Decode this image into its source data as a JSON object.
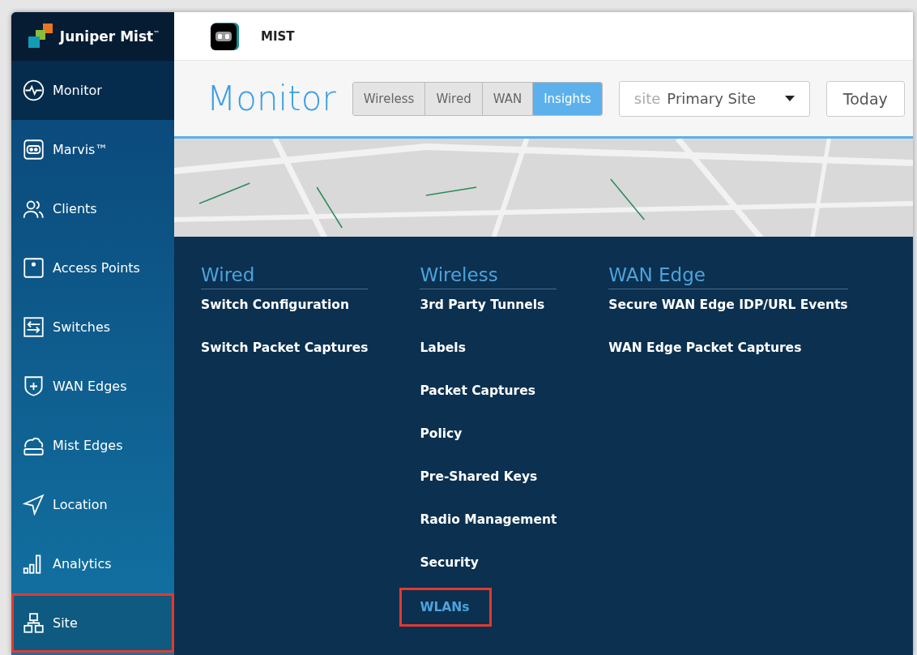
{
  "brand": {
    "name": "Juniper Mist",
    "trademark": "™"
  },
  "header": {
    "org": "MIST"
  },
  "sidebar": {
    "items": [
      {
        "label": "Monitor",
        "kind": "monitor",
        "active": true,
        "highlighted": false
      },
      {
        "label": "Marvis™",
        "kind": "marvis",
        "active": false,
        "highlighted": false
      },
      {
        "label": "Clients",
        "kind": "clients",
        "active": false,
        "highlighted": false
      },
      {
        "label": "Access Points",
        "kind": "ap",
        "active": false,
        "highlighted": false
      },
      {
        "label": "Switches",
        "kind": "switch",
        "active": false,
        "highlighted": false
      },
      {
        "label": "WAN Edges",
        "kind": "wan",
        "active": false,
        "highlighted": false
      },
      {
        "label": "Mist Edges",
        "kind": "mistedge",
        "active": false,
        "highlighted": false
      },
      {
        "label": "Location",
        "kind": "location",
        "active": false,
        "highlighted": false
      },
      {
        "label": "Analytics",
        "kind": "analytics",
        "active": false,
        "highlighted": false
      },
      {
        "label": "Site",
        "kind": "site",
        "active": false,
        "highlighted": true
      }
    ]
  },
  "page": {
    "title": "Monitor",
    "tabs": [
      {
        "label": "Wireless",
        "selected": false
      },
      {
        "label": "Wired",
        "selected": false
      },
      {
        "label": "WAN",
        "selected": false
      },
      {
        "label": "Insights",
        "selected": true
      }
    ],
    "site_select": {
      "label": "site",
      "value": "Primary Site"
    },
    "date_button": "Today"
  },
  "menu": {
    "columns": [
      {
        "title": "Wired",
        "items": [
          {
            "label": "Switch Configuration",
            "highlighted": false
          },
          {
            "label": "Switch Packet Captures",
            "highlighted": false
          }
        ]
      },
      {
        "title": "Wireless",
        "items": [
          {
            "label": "3rd Party Tunnels",
            "highlighted": false
          },
          {
            "label": "Labels",
            "highlighted": false
          },
          {
            "label": "Packet Captures",
            "highlighted": false
          },
          {
            "label": "Policy",
            "highlighted": false
          },
          {
            "label": "Pre-Shared Keys",
            "highlighted": false
          },
          {
            "label": "Radio Management",
            "highlighted": false
          },
          {
            "label": "Security",
            "highlighted": false
          },
          {
            "label": "WLANs",
            "highlighted": true
          }
        ]
      },
      {
        "title": "WAN Edge",
        "items": [
          {
            "label": "Secure WAN Edge IDP/URL Events",
            "highlighted": false
          },
          {
            "label": "WAN Edge Packet Captures",
            "highlighted": false
          }
        ]
      }
    ]
  }
}
